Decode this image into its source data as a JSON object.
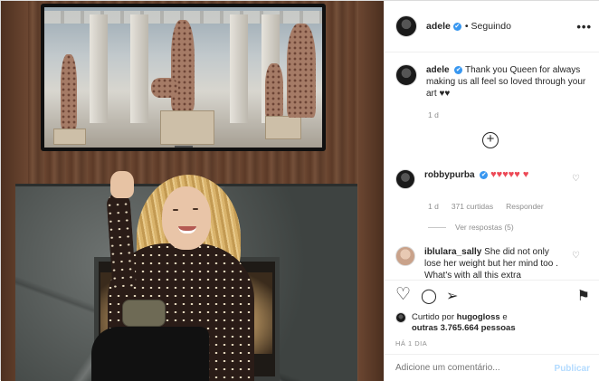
{
  "post": {
    "author": "adele",
    "verified_mark": "✔",
    "separator": "•",
    "follow_status": "Seguindo",
    "more_icon": "more-icon"
  },
  "caption": {
    "user": "adele",
    "text": "Thank you Queen for always making us all feel so loved through your art ♥♥",
    "time": "1 d"
  },
  "load_more": {
    "icon": "plus-circle-icon",
    "label": "+"
  },
  "comments": [
    {
      "user": "robbypurba",
      "text": "♥♥♥♥♥ ♥",
      "time": "1 d",
      "likes": "371 curtidas",
      "reply": "Responder",
      "view_replies": "Ver respostas (5)"
    },
    {
      "user": "iblulara_sally",
      "text": "She did not only lose her weight but her mind too . What's with all this extra"
    }
  ],
  "actions": {
    "like_glyph": "♡",
    "comment_glyph": "◯",
    "share_glyph": "➢",
    "save_glyph": "⚑"
  },
  "likes": {
    "prefix": "Curtido por",
    "user": "hugogloss",
    "conj": "e",
    "others": "outras 3.765.664 pessoas"
  },
  "timestamp": "HÁ 1 DIA",
  "comment_box": {
    "placeholder": "Adicione um comentário...",
    "publish": "Publicar"
  },
  "colors": {
    "accent": "#3897f0",
    "publish_disabled": "#b3dbff",
    "heart": "#ed4956"
  }
}
